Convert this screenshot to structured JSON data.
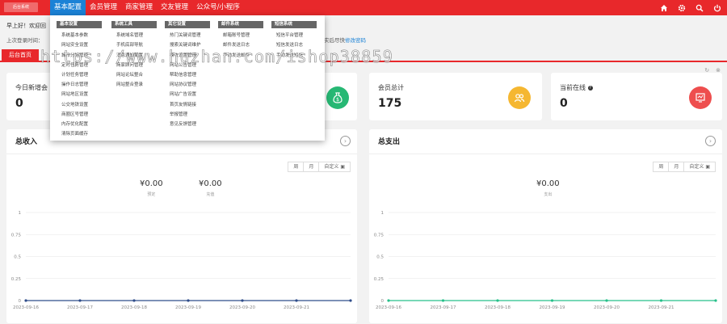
{
  "header": {
    "logo_text": "后台系统",
    "nav": [
      "基本配置",
      "会员管理",
      "商家管理",
      "交友管理",
      "公众号/小程序"
    ],
    "icons": [
      "home-icon",
      "gear-icon",
      "search-icon",
      "power-icon"
    ]
  },
  "welcome": {
    "greeting": "早上好！欢迎回",
    "last_login": "上次登录时间：",
    "tail_text": "实后尽快",
    "change_pwd": "修改密码"
  },
  "tabs": {
    "home": "后台首页"
  },
  "stats": [
    {
      "label": "今日新增会",
      "value": "0",
      "color": "#27b874"
    },
    {
      "label": "会员总计",
      "value": "175",
      "color": "#f5b731"
    },
    {
      "label": "当前在线",
      "value": "0",
      "color": "#ee4e4e",
      "info": "?"
    }
  ],
  "income": {
    "title": "总收入",
    "range": [
      "周",
      "月",
      "自定义"
    ],
    "sums": [
      {
        "value": "¥0.00",
        "label": "预定"
      },
      {
        "value": "¥0.00",
        "label": "充值"
      }
    ],
    "line_color": "#2f4d8a"
  },
  "expense": {
    "title": "总支出",
    "range": [
      "周",
      "月",
      "自定义"
    ],
    "sums": [
      {
        "value": "¥0.00",
        "label": "支出"
      }
    ],
    "line_color": "#27c08a"
  },
  "chart_data": [
    {
      "type": "line",
      "title": "总收入",
      "x": [
        "2023-09-16",
        "2023-09-17",
        "2023-09-18",
        "2023-09-19",
        "2023-09-20",
        "2023-09-21"
      ],
      "series": [
        {
          "values": [
            0,
            0,
            0,
            0,
            0,
            0,
            0
          ]
        }
      ],
      "yticks": [
        "1",
        "0.75",
        "0.5",
        "0.25",
        "0"
      ],
      "ylim": [
        0,
        1
      ]
    },
    {
      "type": "line",
      "title": "总支出",
      "x": [
        "2023-09-16",
        "2023-09-17",
        "2023-09-18",
        "2023-09-19",
        "2023-09-20",
        "2023-09-21"
      ],
      "series": [
        {
          "values": [
            0,
            0,
            0,
            0,
            0,
            0,
            0
          ]
        }
      ],
      "yticks": [
        "1",
        "0.75",
        "0.5",
        "0.25",
        "0"
      ],
      "ylim": [
        0,
        1
      ]
    }
  ],
  "menu": [
    {
      "head": "基本设置",
      "items": [
        "系统基本参数",
        "网站安全设置",
        "城市分站管理",
        "定时任务管理",
        "计划任务管理",
        "操作日志管理",
        "网站地区设置",
        "公交地铁设置",
        "商圈区号管理",
        "内存优化配置",
        "清除页面缓存"
      ]
    },
    {
      "head": "系统工具",
      "items": [
        "系统域名管理",
        "手机底部导航",
        "消息通知配置",
        "商家顾问管理",
        "网站论坛整合",
        "网站整合登录"
      ]
    },
    {
      "head": "其它设置",
      "items": [
        "热门关键词管理",
        "搜索关键词维护",
        "模块设置管理",
        "网站公告管理",
        "帮助信息管理",
        "网站协议管理",
        "网站广告设置",
        "首页友情链接",
        "举报管理",
        "意见反馈管理"
      ]
    },
    {
      "head": "邮件系统",
      "items": [
        "邮箱账号管理",
        "邮件发送日志",
        "手动发送邮件"
      ]
    },
    {
      "head": "短信系统",
      "items": [
        "短信平台管理",
        "短信发送日志",
        "手动发送短信"
      ]
    }
  ],
  "watermark": "https://www.huzhan.com/ishop38859"
}
